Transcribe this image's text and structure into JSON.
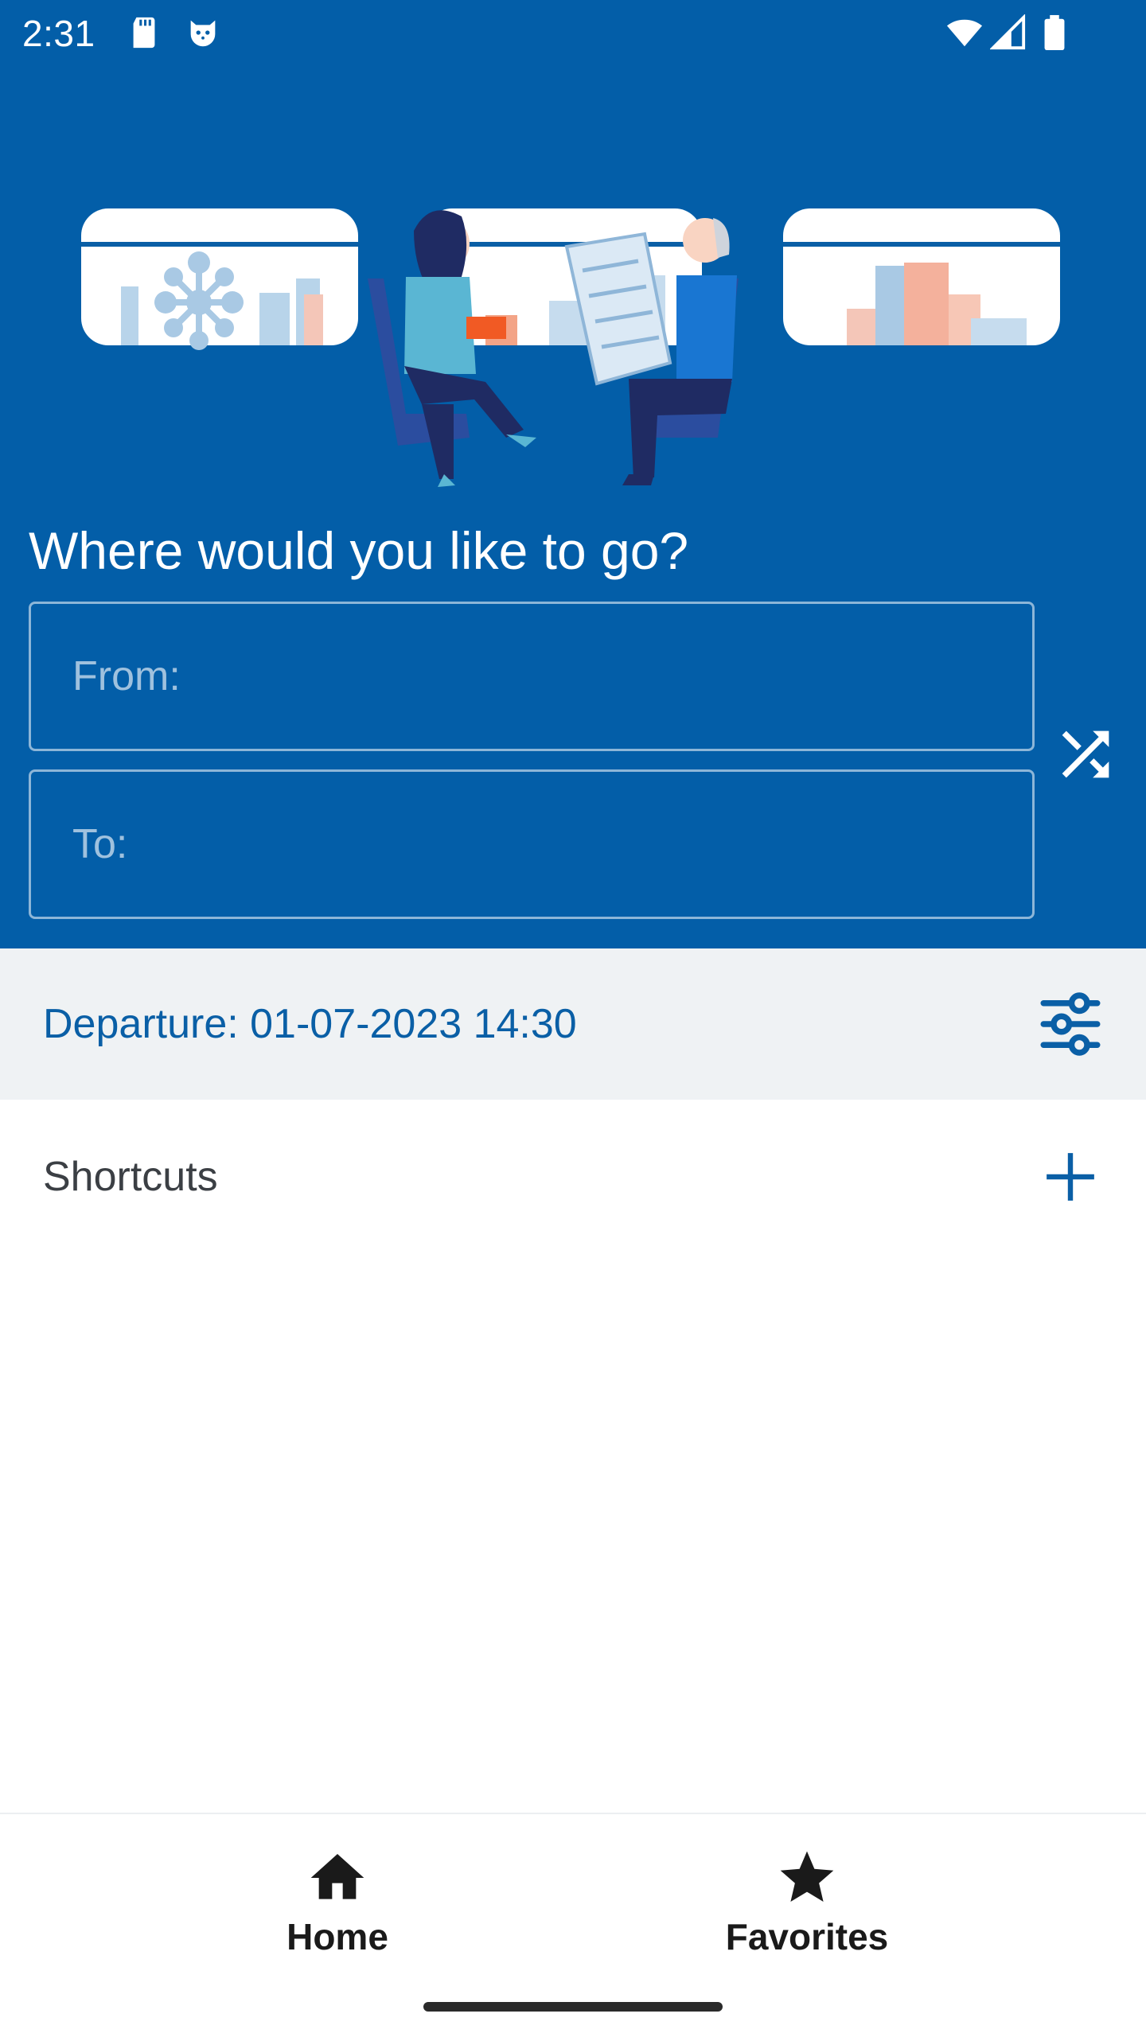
{
  "status_bar": {
    "time": "2:31",
    "icons": [
      "sd-card-icon",
      "cat-icon",
      "wifi-icon",
      "signal-icon",
      "battery-icon"
    ]
  },
  "header": {
    "title": "Where would you like to go?",
    "from_placeholder": "From:",
    "to_placeholder": "To:",
    "swap_icon": "shuffle-icon",
    "illustration": "train-passengers-illustration"
  },
  "departure": {
    "label": "Departure: 01-07-2023 14:30",
    "filter_icon": "tune-sliders-icon"
  },
  "shortcuts": {
    "label": "Shortcuts",
    "add_icon": "plus-icon"
  },
  "bottom_nav": {
    "items": [
      {
        "label": "Home",
        "icon": "home-icon"
      },
      {
        "label": "Favorites",
        "icon": "star-icon"
      }
    ]
  },
  "colors": {
    "brand_blue": "#035ea8",
    "accent_blue": "#0a5fa6",
    "departure_bg": "#eff2f4",
    "white": "#ffffff"
  }
}
